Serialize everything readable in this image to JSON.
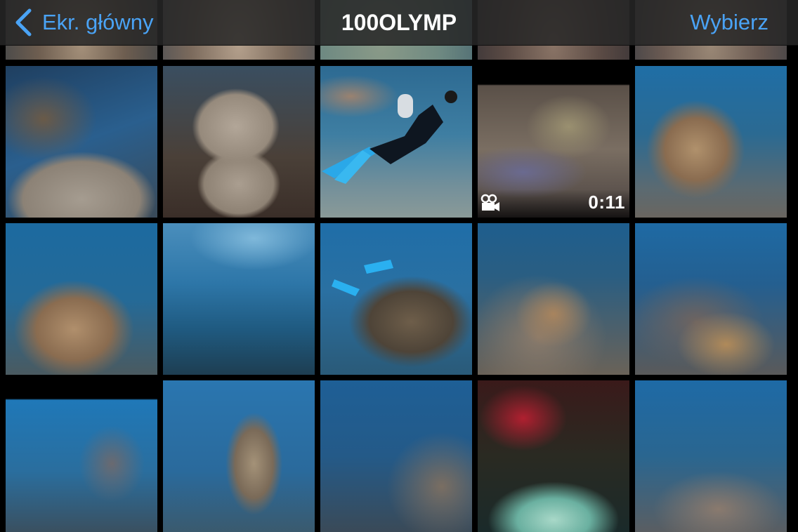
{
  "navbar": {
    "back_label": "Ekr. główny",
    "title": "100OLYMP",
    "select_label": "Wybierz"
  },
  "accent_color": "#4aa3f5",
  "video": {
    "icon": "video-camera-icon",
    "duration": "0:11"
  },
  "photos": [
    "coral-reef-photo",
    "coral-reef-photo",
    "coral-reef-photo",
    "coral-reef-photo",
    "coral-reef-photo",
    "brain-coral-photo",
    "brain-coral-photo",
    "diver-photo",
    "reef-video-thumbnail",
    "staghorn-coral-photo",
    "staghorn-coral-diver-photo",
    "open-water-photo",
    "divers-above-coral-photo",
    "reef-fish-photo",
    "reef-fish-photo",
    "coral-pinnacle-photo",
    "coral-pinnacle-photo",
    "diver-reef-photo",
    "red-coral-closeup-photo",
    "reef-slope-photo"
  ]
}
